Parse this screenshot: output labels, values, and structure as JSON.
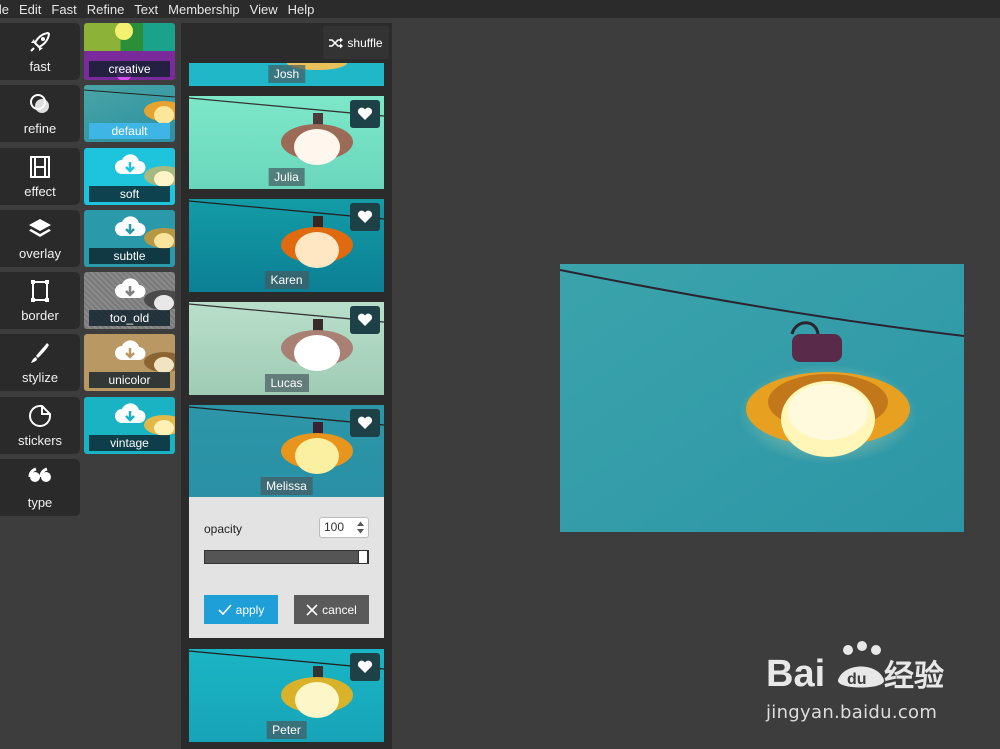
{
  "menubar": {
    "items": [
      "File",
      "Edit",
      "Fast",
      "Refine",
      "Text",
      "Membership",
      "View",
      "Help"
    ],
    "first_visible": "ile"
  },
  "toolbar": {
    "items": [
      {
        "label": "fast",
        "icon": "rocket-icon"
      },
      {
        "label": "refine",
        "icon": "circles-icon"
      },
      {
        "label": "effect",
        "icon": "film-icon"
      },
      {
        "label": "overlay",
        "icon": "layers-icon"
      },
      {
        "label": "border",
        "icon": "frame-icon"
      },
      {
        "label": "stylize",
        "icon": "brush-icon"
      },
      {
        "label": "stickers",
        "icon": "sticker-icon"
      },
      {
        "label": "type",
        "icon": "quote-icon"
      }
    ]
  },
  "effects": {
    "items": [
      {
        "label": "creative",
        "active": false,
        "download": false
      },
      {
        "label": "default",
        "active": true,
        "download": false
      },
      {
        "label": "soft",
        "active": false,
        "download": true
      },
      {
        "label": "subtle",
        "active": false,
        "download": true
      },
      {
        "label": "too_old",
        "active": false,
        "download": true
      },
      {
        "label": "unicolor",
        "active": false,
        "download": true
      },
      {
        "label": "vintage",
        "active": false,
        "download": true
      }
    ]
  },
  "filters": {
    "shuffle_label": "shuffle",
    "items": [
      {
        "name": "Josh"
      },
      {
        "name": "Julia"
      },
      {
        "name": "Karen"
      },
      {
        "name": "Lucas"
      },
      {
        "name": "Melissa"
      },
      {
        "name": "Peter"
      }
    ]
  },
  "opacity": {
    "label": "opacity",
    "value": "100",
    "slider_fraction": 1.0,
    "apply_label": "apply",
    "cancel_label": "cancel"
  },
  "watermark": {
    "brand": "Bai du 经验",
    "url": "jingyan.baidu.com"
  },
  "colors": {
    "accent": "#1e9fd8",
    "active_effect": "#3fb5e6",
    "toolbar_bg": "#2a2a2a",
    "canvas_bg": "#3d3d3d"
  }
}
